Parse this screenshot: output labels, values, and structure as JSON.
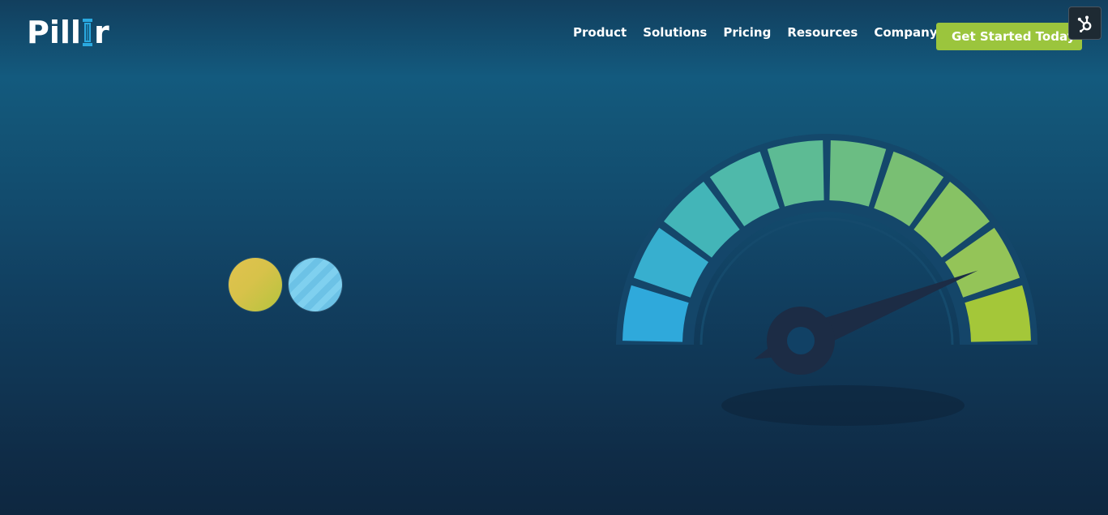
{
  "brand": {
    "logo_text_left": "Pill",
    "logo_text_right": "r",
    "logo_pillar_color": "#2aa9e0"
  },
  "nav": {
    "items": [
      {
        "label": "Product"
      },
      {
        "label": "Solutions"
      },
      {
        "label": "Pricing"
      },
      {
        "label": "Resources"
      },
      {
        "label": "Company"
      }
    ]
  },
  "cta": {
    "label": "Get Started Today",
    "color": "#9bc53d"
  },
  "hubspot_widget": {
    "icon": "hubspot-sprocket-icon"
  },
  "indicators": [
    {
      "name": "yellow-dot",
      "color": "#d9c34b"
    },
    {
      "name": "blue-dot",
      "color": "#79cbec"
    }
  ],
  "gauge": {
    "segment_colors": [
      "#2fa9db",
      "#37afcf",
      "#43b5b8",
      "#4fb9aa",
      "#5dbb94",
      "#6bbd83",
      "#79bf73",
      "#87c264",
      "#94c458",
      "#a4c739"
    ],
    "needle_color": "#1c2c45",
    "needle_level": 0.88
  }
}
